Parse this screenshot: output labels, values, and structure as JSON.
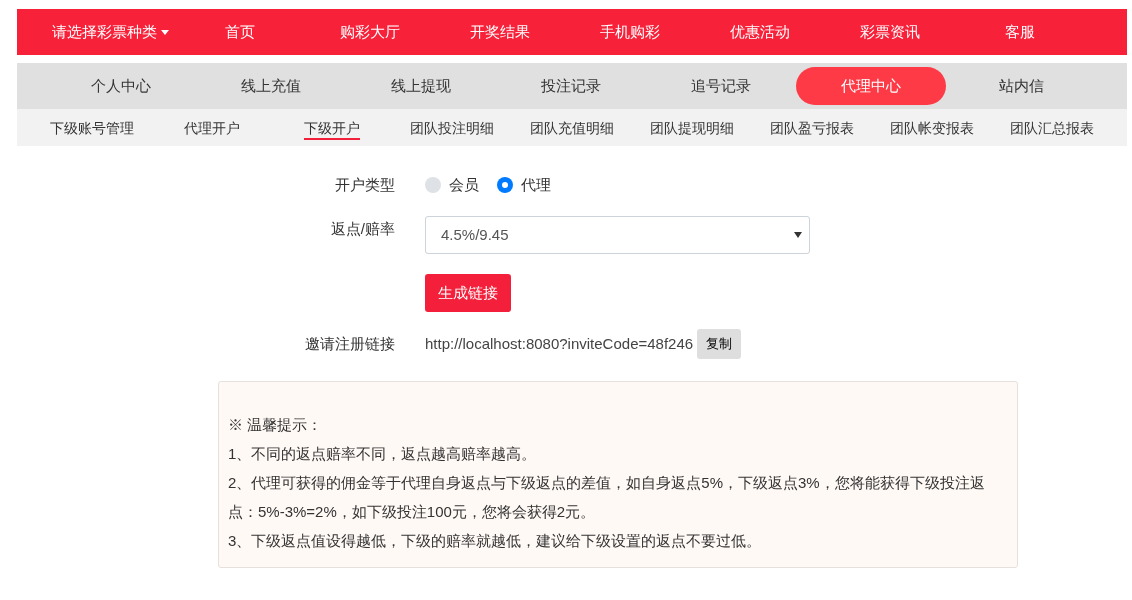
{
  "top_nav": [
    {
      "label": "请选择彩票种类",
      "dropdown": true
    },
    {
      "label": "首页",
      "dropdown": false
    },
    {
      "label": "购彩大厅",
      "dropdown": false
    },
    {
      "label": "开奖结果",
      "dropdown": false
    },
    {
      "label": "手机购彩",
      "dropdown": false
    },
    {
      "label": "优惠活动",
      "dropdown": false
    },
    {
      "label": "彩票资讯",
      "dropdown": false
    },
    {
      "label": "客服",
      "dropdown": false
    }
  ],
  "user_nav": [
    {
      "label": "个人中心",
      "selected": false
    },
    {
      "label": "线上充值",
      "selected": false
    },
    {
      "label": "线上提现",
      "selected": false
    },
    {
      "label": "投注记录",
      "selected": false
    },
    {
      "label": "追号记录",
      "selected": false
    },
    {
      "label": "代理中心",
      "selected": true
    },
    {
      "label": "站内信",
      "selected": false
    }
  ],
  "agent_nav": [
    {
      "label": "下级账号管理",
      "selected": false
    },
    {
      "label": "代理开户",
      "selected": false
    },
    {
      "label": "下级开户",
      "selected": true
    },
    {
      "label": "团队投注明细",
      "selected": false
    },
    {
      "label": "团队充值明细",
      "selected": false
    },
    {
      "label": "团队提现明细",
      "selected": false
    },
    {
      "label": "团队盈亏报表",
      "selected": false
    },
    {
      "label": "团队帐变报表",
      "selected": false
    },
    {
      "label": "团队汇总报表",
      "selected": false
    }
  ],
  "form": {
    "account_type": {
      "label": "开户类型",
      "options": [
        {
          "label": "会员",
          "selected": false
        },
        {
          "label": "代理",
          "selected": true
        }
      ]
    },
    "rebate": {
      "label": "返点/赔率",
      "value": "4.5%/9.45"
    },
    "generate_button": "生成链接",
    "invite_link": {
      "label": "邀请注册链接",
      "value": "http://localhost:8080?inviteCode=48f246",
      "copy_button": "复制"
    }
  },
  "tips": {
    "title": "※ 温馨提示：",
    "lines": [
      "1、不同的返点赔率不同，返点越高赔率越高。",
      "2、代理可获得的佣金等于代理自身返点与下级返点的差值，如自身返点5%，下级返点3%，您将能获得下级投注返点：5%-3%=2%，如下级投注100元，您将会获得2元。",
      "3、下级返点值设得越低，下级的赔率就越低，建议给下级设置的返点不要过低。"
    ]
  }
}
